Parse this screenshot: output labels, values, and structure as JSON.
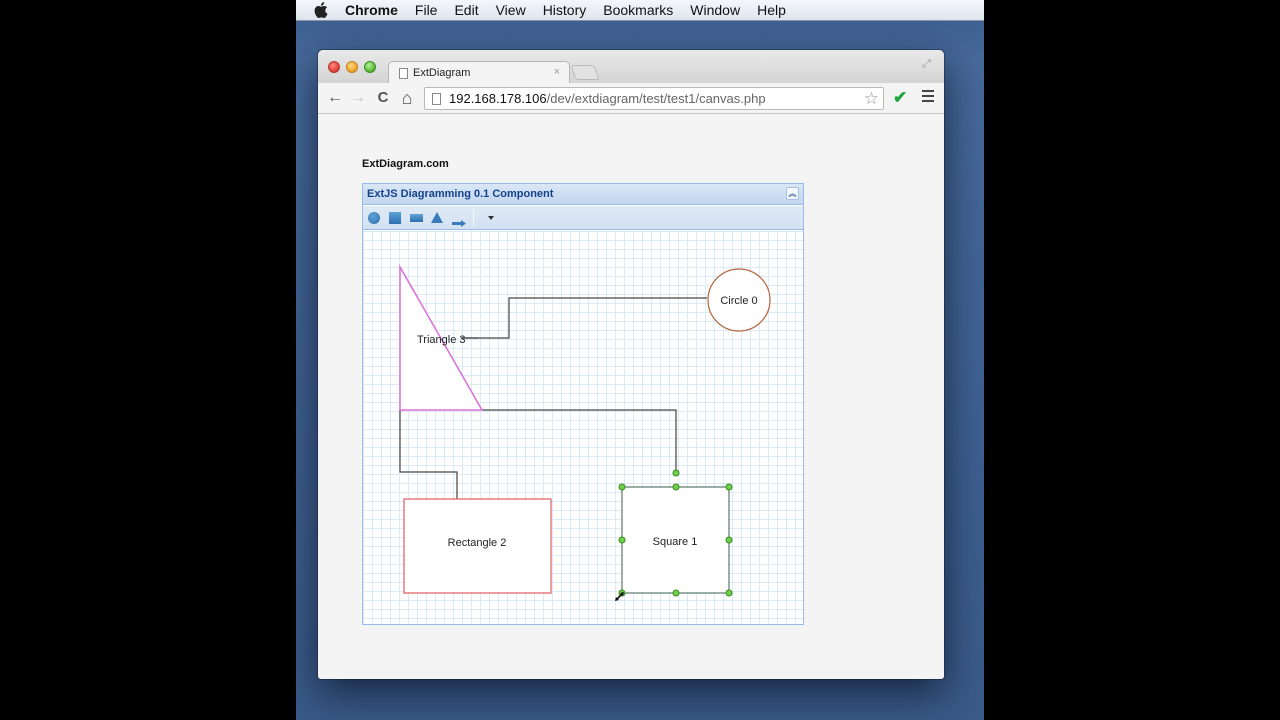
{
  "menubar": {
    "apple_icon": "apple-logo-icon",
    "items": [
      "Chrome",
      "File",
      "Edit",
      "View",
      "History",
      "Bookmarks",
      "Window",
      "Help"
    ]
  },
  "browser": {
    "tab": {
      "title": "ExtDiagram",
      "icon": "page-icon",
      "close_icon": "close-icon"
    },
    "nav": {
      "back_icon": "arrow-left-icon",
      "forward_icon": "arrow-right-icon",
      "reload_icon": "reload-icon",
      "home_icon": "home-icon"
    },
    "address": {
      "host": "192.168.178.106",
      "path": "/dev/extdiagram/test/test1/canvas.php"
    },
    "glyphs": {
      "back": "←",
      "forward": "→",
      "reload": "C",
      "home": "⌂",
      "star": "☆",
      "check": "✔",
      "tab_close": "×",
      "fullscreen": "⤢"
    }
  },
  "page": {
    "site_title": "ExtDiagram.com",
    "panel": {
      "title": "ExtJS Diagramming 0.1 Component",
      "collapse_glyph": "︽",
      "tools": [
        {
          "name": "circle",
          "icon": "circle-tool-icon"
        },
        {
          "name": "square",
          "icon": "square-tool-icon"
        },
        {
          "name": "rectangle",
          "icon": "rectangle-tool-icon"
        },
        {
          "name": "triangle",
          "icon": "triangle-tool-icon"
        },
        {
          "name": "connector",
          "icon": "arrow-tool-icon"
        },
        {
          "name": "more",
          "icon": "dropdown-caret-icon"
        }
      ]
    },
    "diagram": {
      "colors": {
        "circle_stroke": "#b5643c",
        "triangle_stroke": "#d96fd9",
        "rectangle_stroke": "#e05b5b",
        "square_stroke": "#5a7a6a",
        "connector": "#444444",
        "handle_fill": "#6fd14a",
        "handle_stroke": "#3a8a20"
      },
      "shapes": [
        {
          "id": "circle0",
          "type": "circle",
          "label": "Circle 0"
        },
        {
          "id": "square1",
          "type": "square",
          "label": "Square 1",
          "selected": true
        },
        {
          "id": "rect2",
          "type": "rectangle",
          "label": "Rectangle 2"
        },
        {
          "id": "tri3",
          "type": "triangle",
          "label": "Triangle 3"
        }
      ],
      "connections": [
        {
          "from": "tri3",
          "to": "circle0"
        },
        {
          "from": "tri3",
          "to": "square1"
        },
        {
          "from": "tri3",
          "to": "rect2"
        }
      ]
    }
  }
}
